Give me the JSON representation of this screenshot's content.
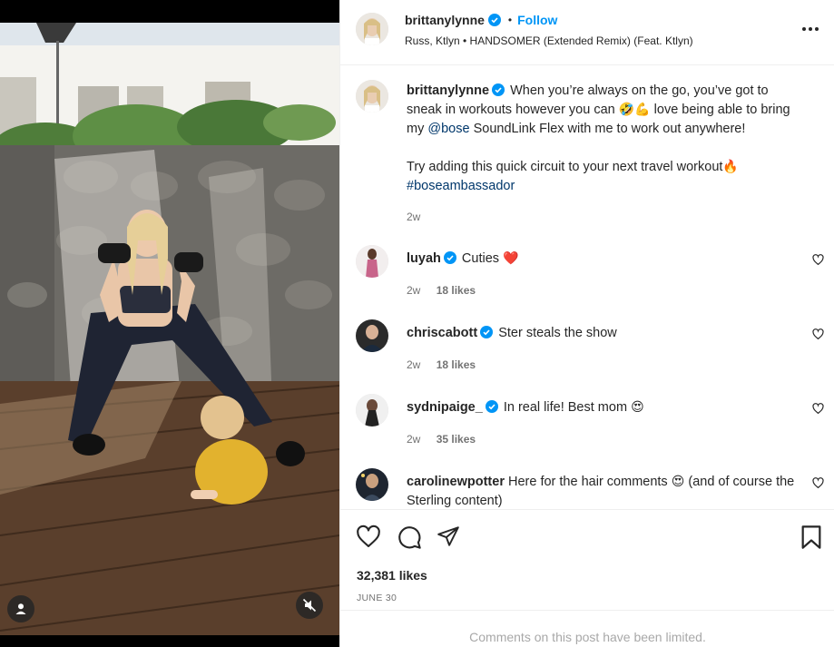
{
  "post": {
    "author": "brittanylynne",
    "follow_label": "Follow",
    "separator": "•",
    "audio": "Russ, Ktlyn • HANDSOMER (Extended Remix) (Feat. Ktlyn)",
    "caption": {
      "username": "brittanylynne",
      "text_part1": "When you’re always on the go, you’ve got to sneak in workouts however you can",
      "emoji1": "🤣💪",
      "text_part2": "love being able to bring my",
      "mention": "@bose",
      "text_part3": "SoundLink Flex with me to work out anywhere!",
      "text_part4": "Try adding this quick circuit to your next travel workout",
      "emoji2": "🔥",
      "hashtag": "#boseambassador",
      "age": "2w"
    },
    "comments": [
      {
        "username": "luyah",
        "verified": true,
        "text": "Cuties",
        "emoji": "❤️",
        "age": "2w",
        "likes": "18 likes"
      },
      {
        "username": "chriscabott",
        "verified": true,
        "text": "Ster steals the show",
        "emoji": "",
        "age": "2w",
        "likes": "18 likes"
      },
      {
        "username": "sydnipaige_",
        "verified": true,
        "text": "In real life! Best mom",
        "emoji": "😍",
        "age": "2w",
        "likes": "35 likes"
      },
      {
        "username": "carolinewpotter",
        "verified": false,
        "text": "Here for the hair comments",
        "emoji": "😍",
        "text_after": "(and of course the Sterling content)"
      }
    ],
    "likes": "32,381 likes",
    "date": "JUNE 30",
    "comments_limited": "Comments on this post have been limited."
  },
  "colors": {
    "link": "#00376b",
    "follow": "#0095f6",
    "verified": "#0095f6",
    "muted": "#737373"
  },
  "icons": {
    "more": "more-horizontal-icon",
    "like": "heart-icon",
    "comment": "comment-icon",
    "share": "paper-plane-icon",
    "save": "bookmark-icon",
    "user_tag": "user-icon",
    "mute": "speaker-muted-icon"
  }
}
